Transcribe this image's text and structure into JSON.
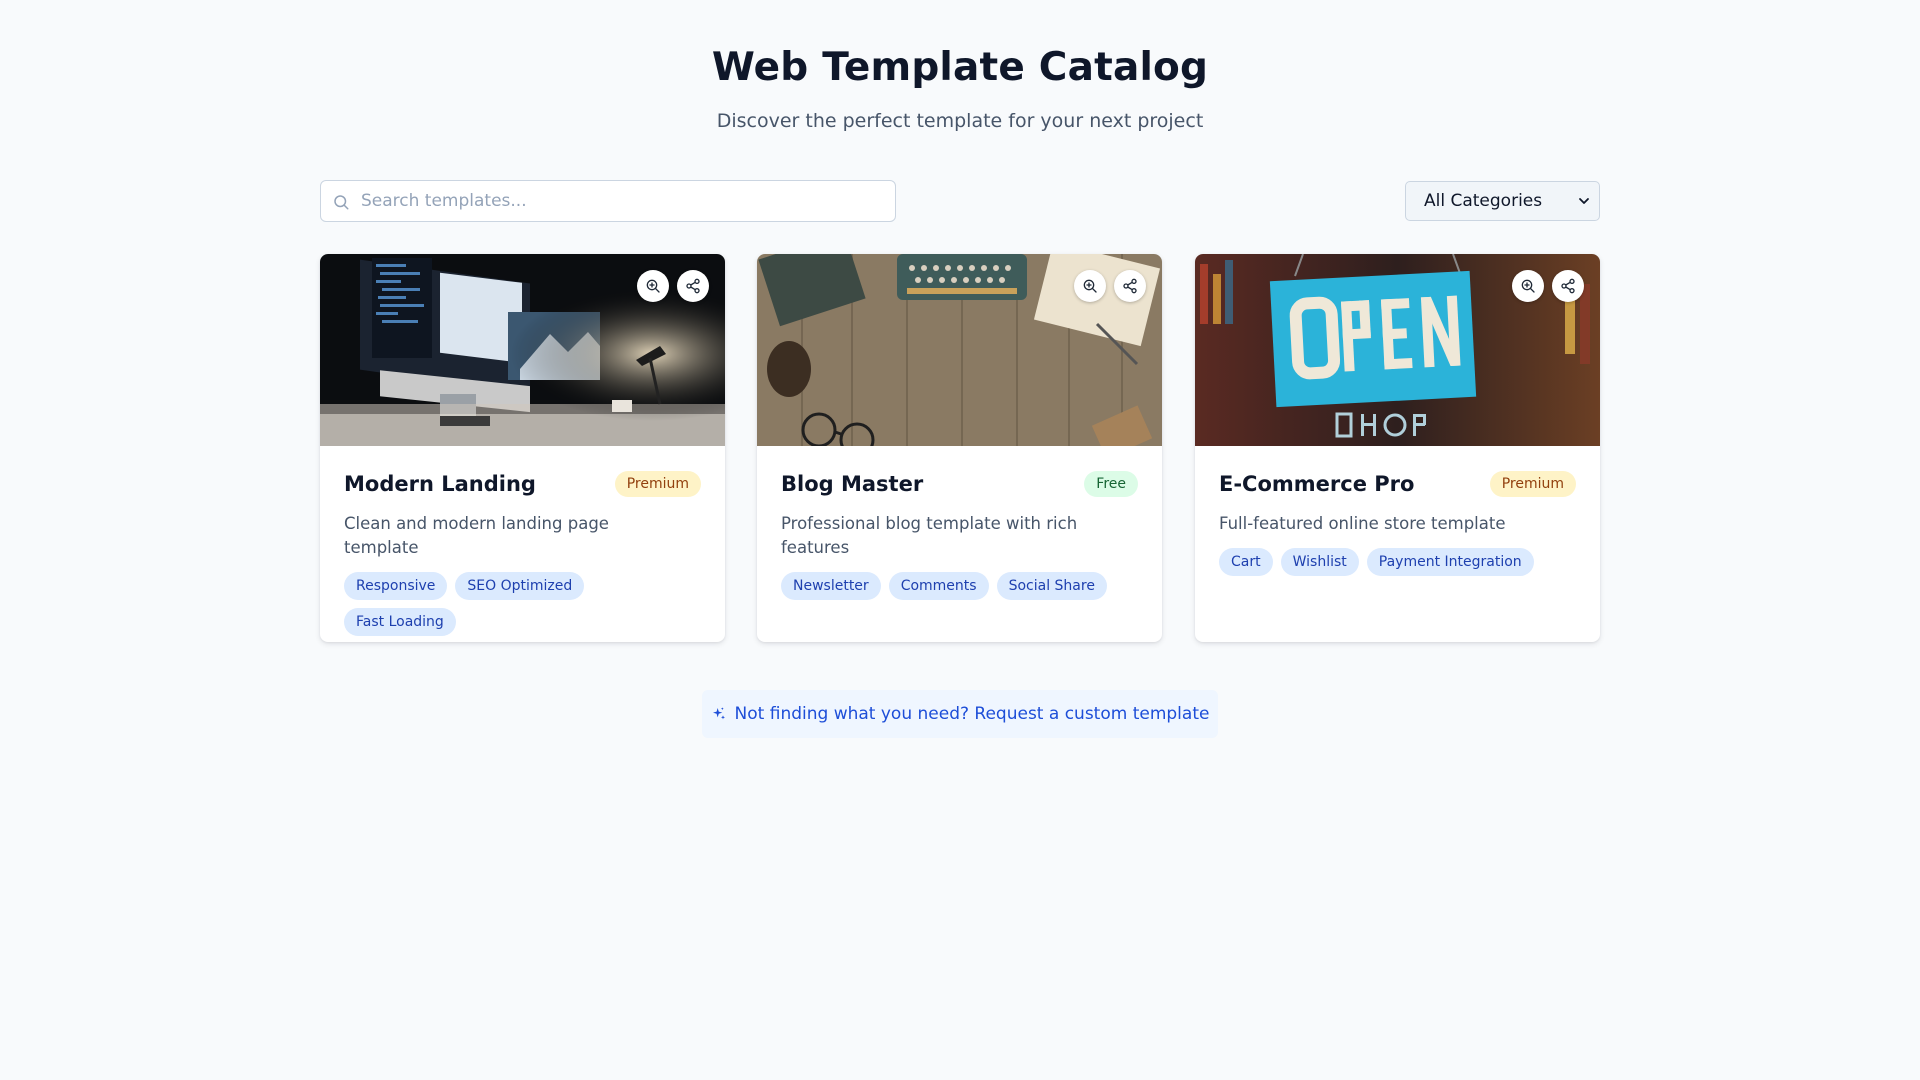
{
  "header": {
    "title": "Web Template Catalog",
    "subtitle": "Discover the perfect template for your next project"
  },
  "search": {
    "placeholder": "Search templates...",
    "value": "",
    "icon": "search-icon"
  },
  "category_filter": {
    "selected": "All Categories"
  },
  "actions": {
    "zoom_icon": "zoom-in-icon",
    "share_icon": "share-icon"
  },
  "templates": [
    {
      "title": "Modern Landing",
      "badge": "Premium",
      "description": "Clean and modern landing page template",
      "tags": [
        "Responsive",
        "SEO Optimized",
        "Fast Loading"
      ],
      "image": "desk-with-monitors-photo"
    },
    {
      "title": "Blog Master",
      "badge": "Free",
      "description": "Professional blog template with rich features",
      "tags": [
        "Newsletter",
        "Comments",
        "Social Share"
      ],
      "image": "typewriter-on-wood-photo"
    },
    {
      "title": "E-Commerce Pro",
      "badge": "Premium",
      "description": "Full-featured online store template",
      "tags": [
        "Cart",
        "Wishlist",
        "Payment Integration"
      ],
      "image": "open-shop-sign-photo"
    }
  ],
  "request": {
    "label": "Not finding what you need? Request a custom template",
    "icon": "sparkles-icon"
  },
  "colors": {
    "background": "#f8fafc",
    "accent": "#1d4ed8",
    "premium_badge": "#fef3c7",
    "free_badge": "#dcfce7",
    "tag": "#dbeafe"
  }
}
